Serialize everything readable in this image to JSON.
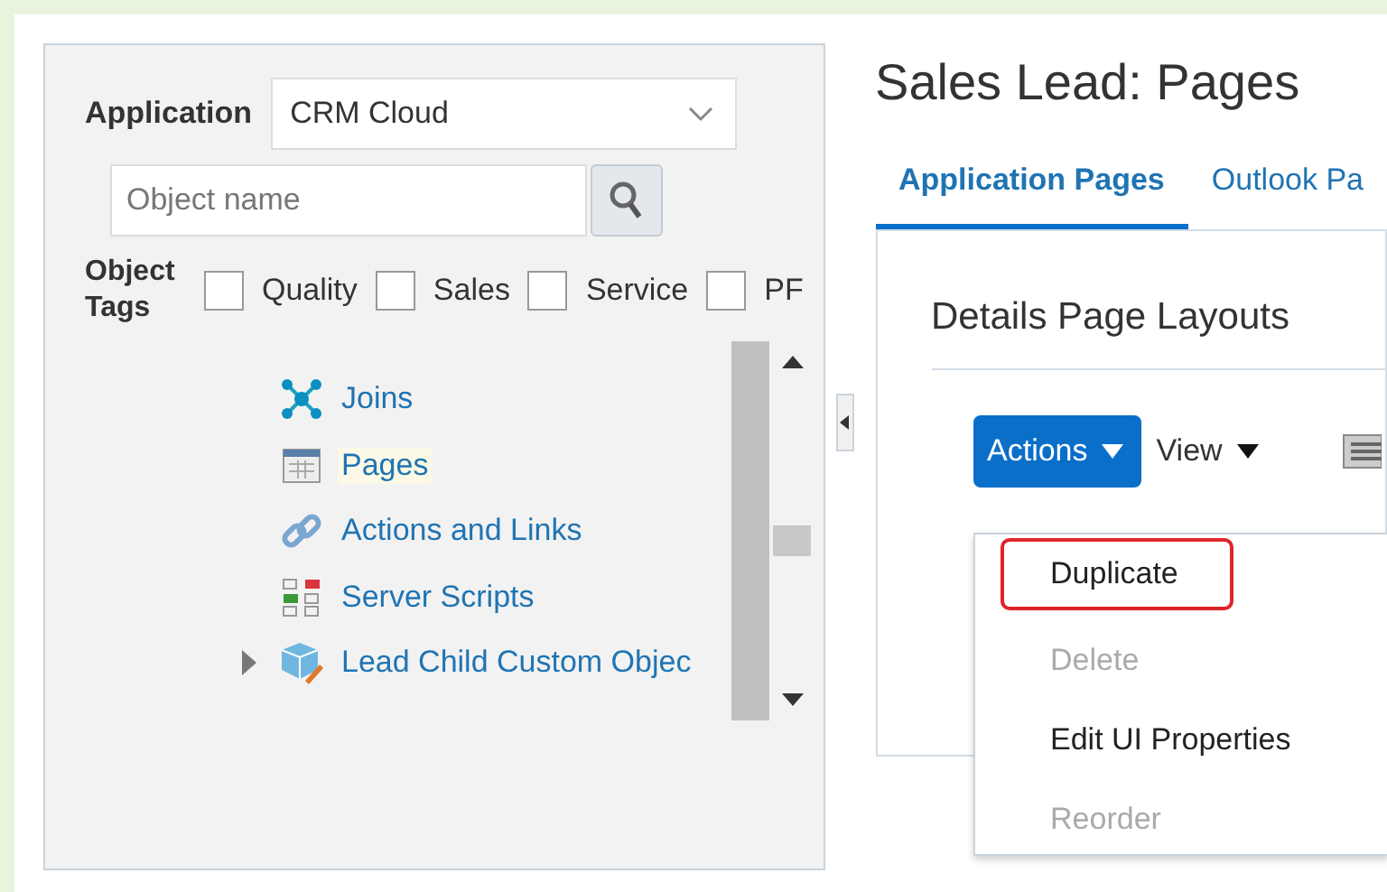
{
  "filter": {
    "application_label": "Application",
    "application_value": "CRM Cloud",
    "search_placeholder": "Object name",
    "tags_label": "Object Tags",
    "tags": [
      {
        "label": "Quality",
        "checked": false
      },
      {
        "label": "Sales",
        "checked": false
      },
      {
        "label": "Service",
        "checked": false
      },
      {
        "label": "PF",
        "checked": false
      }
    ]
  },
  "tree": [
    {
      "label": "Joins",
      "kind": "joins",
      "selected": false
    },
    {
      "label": "Pages",
      "kind": "pages",
      "selected": true
    },
    {
      "label": "Actions and Links",
      "kind": "link",
      "selected": false
    },
    {
      "label": "Server Scripts",
      "kind": "scripts",
      "selected": false
    },
    {
      "label": "Lead Child Custom Objec",
      "kind": "object",
      "selected": false,
      "expanded": false
    }
  ],
  "page": {
    "title": "Sales Lead: Pages",
    "tabs": [
      {
        "label": "Application Pages",
        "selected": true
      },
      {
        "label": "Outlook Pa",
        "selected": false
      }
    ],
    "section_title": "Details Page Layouts",
    "actions_button": "Actions",
    "view_menu": "View",
    "actions_menu": [
      {
        "label": "Duplicate",
        "disabled": false,
        "highlighted": true
      },
      {
        "label": "Delete",
        "disabled": true,
        "highlighted": false
      },
      {
        "label": "Edit UI Properties",
        "disabled": false,
        "highlighted": false
      },
      {
        "label": "Reorder",
        "disabled": true,
        "highlighted": false
      }
    ]
  }
}
